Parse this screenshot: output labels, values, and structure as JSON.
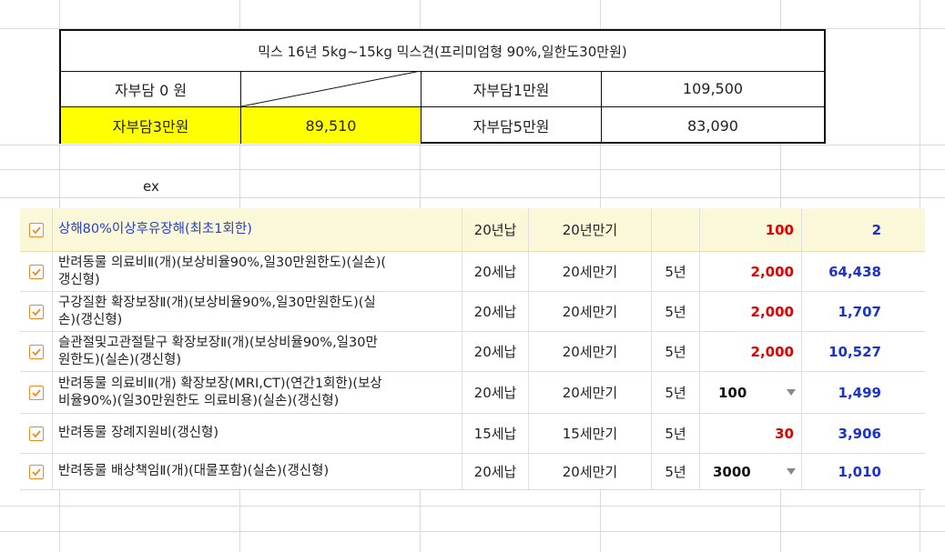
{
  "premium_table": {
    "title": "믹스 16년 5kg~15kg 믹스견(프리미엄형 90%,일한도30만원)",
    "rows": [
      [
        {
          "label": "자부담 0 원",
          "value": ""
        },
        {
          "label": "자부담1만원",
          "value": "109,500"
        }
      ],
      [
        {
          "label": "자부담3만원",
          "value": "89,510",
          "highlight": "#ffff00"
        },
        {
          "label": "자부담5만원",
          "value": "83,090"
        }
      ]
    ]
  },
  "example_label": "ex",
  "coverages": [
    {
      "checked": true,
      "name": "상해80%이상후유장해(최초1회한)",
      "pay_period": "20년납",
      "maturity": "20년만기",
      "renewal": "",
      "amount": "100",
      "amount_type": "red",
      "premium": "2",
      "highlight": true
    },
    {
      "checked": true,
      "name": "반려동물 의료비Ⅱ(개)(보상비율90%,일30만원한도)(실손)(갱신형)",
      "name_lines": [
        "반려동물 의료비Ⅱ(개)(보상비율90%,일30만원한도)(실손)(",
        "갱신형)"
      ],
      "pay_period": "20세납",
      "maturity": "20세만기",
      "renewal": "5년",
      "amount": "2,000",
      "amount_type": "red",
      "premium": "64,438"
    },
    {
      "checked": true,
      "name": "구강질환 확장보장Ⅱ(개)(보상비율90%,일30만원한도)(실손)(갱신형)",
      "name_lines": [
        "구강질환 확장보장Ⅱ(개)(보상비율90%,일30만원한도)(실",
        "손)(갱신형)"
      ],
      "pay_period": "20세납",
      "maturity": "20세만기",
      "renewal": "5년",
      "amount": "2,000",
      "amount_type": "red",
      "premium": "1,707"
    },
    {
      "checked": true,
      "name": "슬관절및고관절탈구 확장보장Ⅱ(개)(보상비율90%,일30만원한도)(실손)(갱신형)",
      "name_lines": [
        "슬관절및고관절탈구 확장보장Ⅱ(개)(보상비율90%,일30만",
        "원한도)(실손)(갱신형)"
      ],
      "pay_period": "20세납",
      "maturity": "20세만기",
      "renewal": "5년",
      "amount": "2,000",
      "amount_type": "red",
      "premium": "10,527"
    },
    {
      "checked": true,
      "name": "반려동물 의료비Ⅱ(개) 확장보장(MRI,CT)(연간1회한)(보상비율90%)(일30만원한도 의료비용)(실손)(갱신형)",
      "name_lines": [
        "반려동물 의료비Ⅱ(개) 확장보장(MRI,CT)(연간1회한)(보상",
        "비율90%)(일30만원한도 의료비용)(실손)(갱신형)"
      ],
      "pay_period": "20세납",
      "maturity": "20세만기",
      "renewal": "5년",
      "amount": "100",
      "amount_type": "dropdown",
      "premium": "1,499"
    },
    {
      "checked": true,
      "name": "반려동물 장례지원비(갱신형)",
      "pay_period": "15세납",
      "maturity": "15세만기",
      "renewal": "5년",
      "amount": "30",
      "amount_type": "red",
      "premium": "3,906"
    },
    {
      "checked": true,
      "name": "반려동물 배상책임Ⅱ(개)(대물포함)(실손)(갱신형)",
      "pay_period": "20세납",
      "maturity": "20세만기",
      "renewal": "5년",
      "amount": "3000",
      "amount_type": "dropdown",
      "premium": "1,010"
    }
  ],
  "icons": {
    "checkbox": "checkmark-icon",
    "dropdown": "chevron-down-icon"
  },
  "colors": {
    "accent_checkbox": "#f08a24",
    "premium_blue": "#1a33c8",
    "amount_red": "#e00000",
    "highlight_yellow": "#ffff00",
    "highlight_row": "#fbf8d9"
  }
}
